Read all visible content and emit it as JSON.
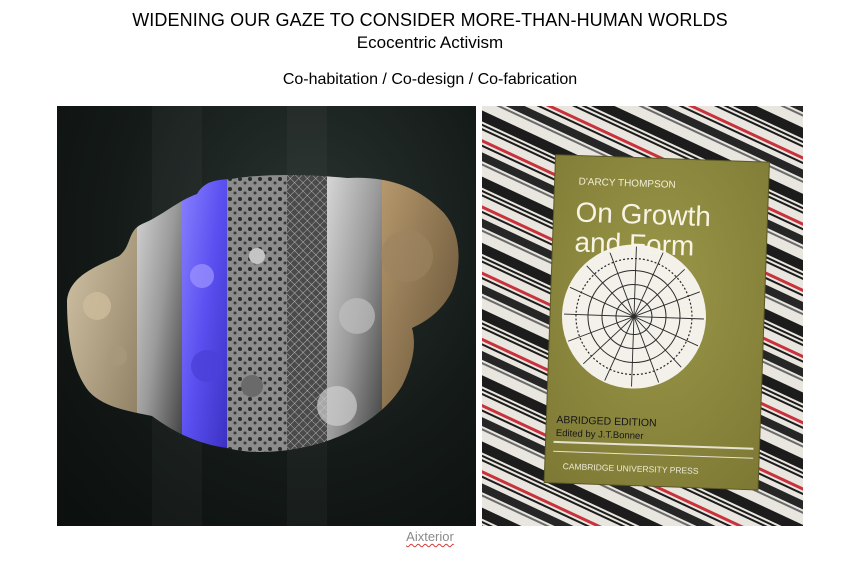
{
  "header": {
    "title": "WIDENING OUR GAZE TO CONSIDER MORE-THAN-HUMAN WORLDS",
    "subtitle": "Ecocentric Activism",
    "tagline": "Co-habitation / Co-design / Co-fabrication"
  },
  "book": {
    "author": "D'ARCY THOMPSON",
    "title_line1": "On Growth",
    "title_line2": "and Form",
    "edition": "ABRIDGED EDITION",
    "editor": "Edited by J.T.Bonner",
    "publisher": "CAMBRIDGE UNIVERSITY PRESS"
  },
  "caption": "Aixterior",
  "colors": {
    "book_cover": "#8e8a3e",
    "sculpture_blue": "#5a4ff0",
    "textile_red": "#c8323c",
    "textile_black": "#1c1c1c"
  }
}
